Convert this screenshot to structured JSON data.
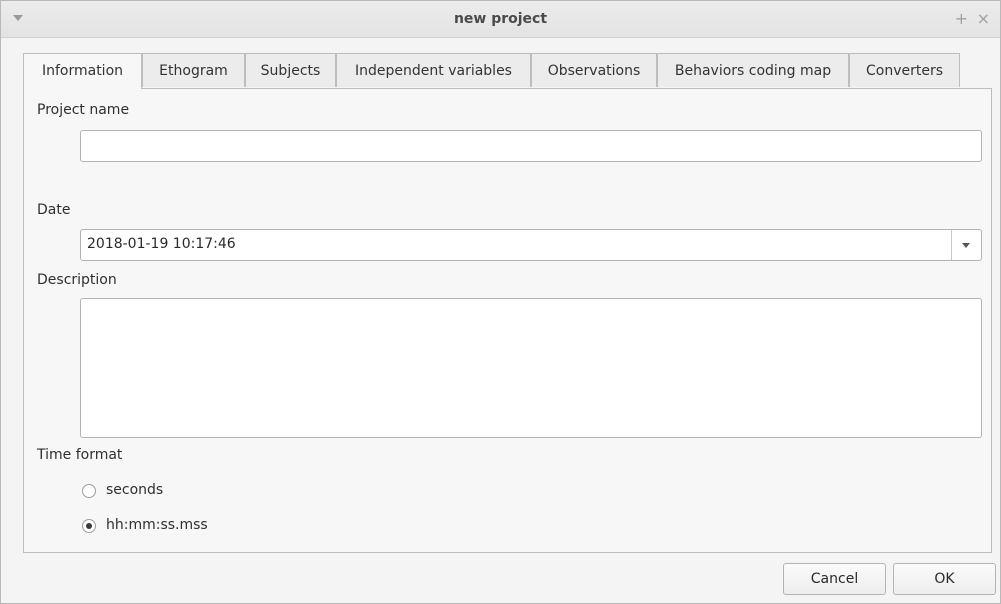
{
  "window": {
    "title": "new project",
    "controls": {
      "plus_icon": "+",
      "close_icon": "×"
    }
  },
  "tabs": [
    {
      "label": "Information",
      "active": true
    },
    {
      "label": "Ethogram",
      "active": false
    },
    {
      "label": "Subjects",
      "active": false
    },
    {
      "label": "Independent variables",
      "active": false
    },
    {
      "label": "Observations",
      "active": false
    },
    {
      "label": "Behaviors coding map",
      "active": false
    },
    {
      "label": "Converters",
      "active": false
    }
  ],
  "info": {
    "project_name_label": "Project name",
    "project_name_value": "",
    "date_label": "Date",
    "date_value": "2018-01-19 10:17:46",
    "description_label": "Description",
    "description_value": "",
    "time_format_label": "Time format",
    "time_format_options": [
      {
        "label": "seconds",
        "checked": false
      },
      {
        "label": "hh:mm:ss.mss",
        "checked": true
      }
    ]
  },
  "buttons": {
    "cancel": "Cancel",
    "ok": "OK"
  },
  "icons": {
    "window_menu": "chevron-down-icon",
    "maximize": "plus-icon",
    "close": "close-icon",
    "dropdown": "chevron-down-icon"
  }
}
